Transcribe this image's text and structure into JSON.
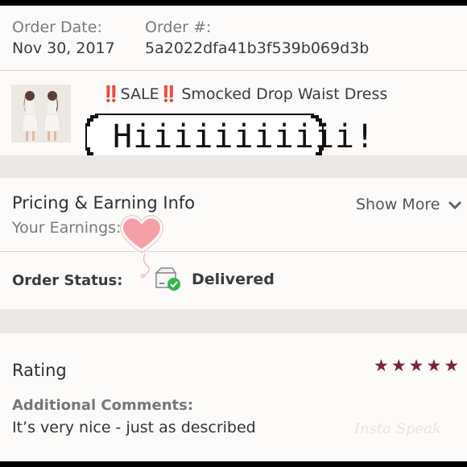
{
  "order": {
    "date_label": "Order Date:",
    "date_value": "Nov 30, 2017",
    "number_label": "Order #:",
    "number_value": "5a2022dfa41b3f539b069d3b"
  },
  "item": {
    "sale_marks": "‼️",
    "sale_word": "SALE",
    "title": "Smocked Drop Waist Dress"
  },
  "sticker": {
    "speech_text": "Hiiiiiiiiiii!"
  },
  "pricing": {
    "title": "Pricing & Earning Info",
    "show_more": "Show More",
    "earnings_label": "Your Earnings:"
  },
  "status": {
    "label": "Order Status:",
    "value": "Delivered"
  },
  "rating": {
    "label": "Rating",
    "stars": 5,
    "comments_label": "Additional Comments:",
    "comments_text": "It’s very nice - just as described"
  },
  "watermark": "Insta Speak",
  "colors": {
    "star": "#7b2434",
    "heart": "#f5a0a6",
    "delivered_check": "#2eb84b",
    "sale_marks": "#e8212b"
  }
}
